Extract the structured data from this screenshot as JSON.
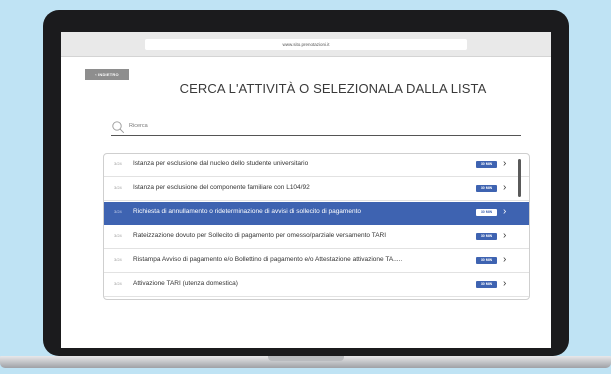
{
  "browser": {
    "url": "www.sito.prenotazioni.it"
  },
  "back_button": {
    "label": "INDIETRO",
    "icon": "chevron-left-icon"
  },
  "page": {
    "title": "CERCA L'ATTIVITÀ O SELEZIONALA DALLA LISTA"
  },
  "search": {
    "placeholder": "Ricerca",
    "icon": "search-icon"
  },
  "list": {
    "selected_index": 2,
    "items": [
      {
        "num": "3/24",
        "label": "Istanza per esclusione dal nucleo dello studente universitario",
        "badge": "30 MIN"
      },
      {
        "num": "3/24",
        "label": "Istanza per esclusione del componente familiare con L104/92",
        "badge": "30 MIN"
      },
      {
        "num": "3/24",
        "label": "Richiesta di annullamento o rideterminazione di avvisi di sollecito di pagamento",
        "badge": "30 MIN"
      },
      {
        "num": "3/24",
        "label": "Rateizzazione dovuto per Sollecito di pagamento per omesso/parziale versamento TARI",
        "badge": "30 MIN"
      },
      {
        "num": "3/24",
        "label": "Ristampa Avviso di pagamento e/o Bollettino di pagamento e/o Attestazione attivazione TA.....",
        "badge": "30 MIN"
      },
      {
        "num": "3/24",
        "label": "Attivazione TARI (utenza domestica)",
        "badge": "30 MIN"
      }
    ]
  },
  "colors": {
    "accent": "#3e63b1",
    "background": "#bfe3f4"
  }
}
